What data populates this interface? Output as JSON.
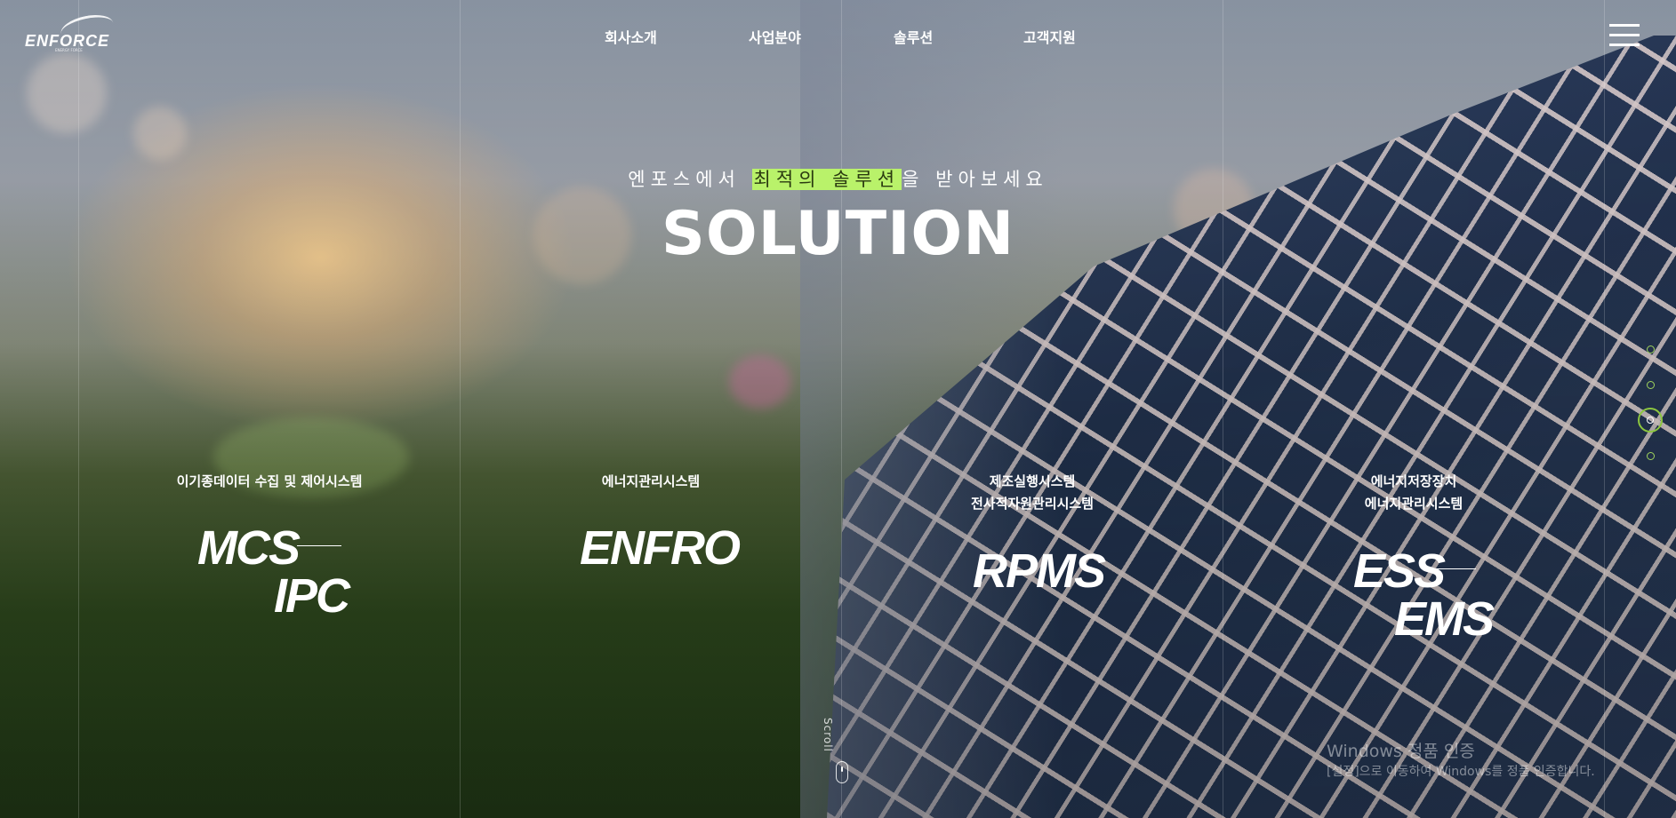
{
  "header": {
    "logo_text": "ENFORCE",
    "logo_subtext": "ENERGY FORCE",
    "nav": [
      "회사소개",
      "사업분야",
      "솔루션",
      "고객지원"
    ]
  },
  "hero": {
    "subtitle_pre": "엔포스에서 ",
    "subtitle_highlight": "최적의 솔루션",
    "subtitle_post": "을 받아보세요",
    "title": "SOLUTION",
    "highlight_color": "#b9f26a"
  },
  "solutions": [
    {
      "desc": [
        "이기종데이터 수집 및 제어시스템"
      ],
      "codes": [
        "MCS",
        "IPC"
      ]
    },
    {
      "desc": [
        "에너지관리시스템"
      ],
      "codes": [
        "ENFRO"
      ]
    },
    {
      "desc": [
        "제조실행시스템",
        "전사적자원관리시스템"
      ],
      "codes": [
        "RPMS"
      ]
    },
    {
      "desc": [
        "에너지저장장치",
        "에너지관리시스템"
      ],
      "codes": [
        "ESS",
        "EMS"
      ]
    }
  ],
  "pagination": {
    "count": 4,
    "active_index": 2,
    "accent_color": "#8cc63f"
  },
  "scroll_label": "Scroll",
  "watermark": {
    "line1": "Windows 정품 인증",
    "line2": "[설정]으로 이동하여 Windows를 정품 인증합니다."
  }
}
